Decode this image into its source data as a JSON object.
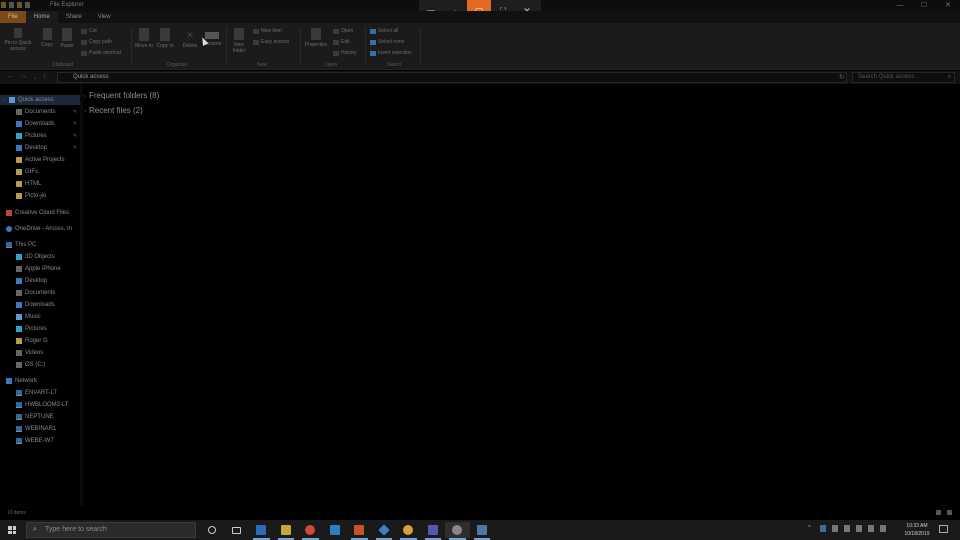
{
  "window": {
    "title": "File Explorer",
    "controls": {
      "minimize": "—",
      "maximize": "☐",
      "close": "✕"
    }
  },
  "snip_toolbar": {
    "buttons": [
      {
        "icon": "rectangle-snip-icon",
        "glyph": "▭"
      },
      {
        "icon": "freeform-snip-icon",
        "glyph": "◌"
      },
      {
        "icon": "window-snip-icon",
        "glyph": "▢",
        "active": true
      },
      {
        "icon": "fullscreen-snip-icon",
        "glyph": "⛶"
      },
      {
        "icon": "close-icon",
        "glyph": "✕"
      }
    ]
  },
  "tabs": [
    "File",
    "Home",
    "Share",
    "View"
  ],
  "ribbon": {
    "clipboard": {
      "pin_label": "Pin to Quick access",
      "copy_label": "Copy",
      "paste_label": "Paste",
      "cut_label": "Cut",
      "copy_path_label": "Copy path",
      "paste_shortcut_label": "Paste shortcut",
      "group_label": "Clipboard"
    },
    "organize": {
      "move_to_label": "Move to",
      "copy_to_label": "Copy to",
      "delete_label": "Delete",
      "rename_label": "Rename",
      "group_label": "Organize"
    },
    "new": {
      "new_folder_label": "New folder",
      "new_item_label": "New item",
      "easy_access_label": "Easy access",
      "group_label": "New"
    },
    "open": {
      "properties_label": "Properties",
      "open_label": "Open",
      "edit_label": "Edit",
      "history_label": "History",
      "group_label": "Open"
    },
    "select": {
      "select_all_label": "Select all",
      "select_none_label": "Select none",
      "invert_selection_label": "Invert selection",
      "group_label": "Select"
    }
  },
  "address_bar": {
    "path": "Quick access",
    "search_placeholder": "Search Quick access"
  },
  "nav_pane": {
    "quick_access_label": "Quick access",
    "quick_access_items": [
      {
        "label": "Documents",
        "icon": "documents-icon",
        "pinned": true
      },
      {
        "label": "Downloads",
        "icon": "downloads-icon",
        "pinned": true
      },
      {
        "label": "Pictures",
        "icon": "pictures-icon",
        "pinned": true
      },
      {
        "label": "Desktop",
        "icon": "desktop-icon",
        "pinned": true
      },
      {
        "label": "Active Projects",
        "icon": "folder-icon",
        "pinned": false
      },
      {
        "label": "GIFs",
        "icon": "folder-icon",
        "pinned": false
      },
      {
        "label": "HTML",
        "icon": "folder-icon",
        "pinned": false
      },
      {
        "label": "Picto-jio",
        "icon": "folder-icon",
        "pinned": false
      }
    ],
    "creative_cloud_label": "Creative Cloud Files",
    "onedrive_label": "OneDrive - Arcoss, In",
    "this_pc_label": "This PC",
    "this_pc_items": [
      {
        "label": "3D Objects",
        "icon": "3d-objects-icon"
      },
      {
        "label": "Apple iPhone",
        "icon": "phone-icon"
      },
      {
        "label": "Desktop",
        "icon": "desktop-icon"
      },
      {
        "label": "Documents",
        "icon": "documents-icon"
      },
      {
        "label": "Downloads",
        "icon": "downloads-icon"
      },
      {
        "label": "Music",
        "icon": "music-icon"
      },
      {
        "label": "Pictures",
        "icon": "pictures-icon"
      },
      {
        "label": "Roger G",
        "icon": "folder-icon"
      },
      {
        "label": "Videos",
        "icon": "videos-icon"
      },
      {
        "label": "OS (C:)",
        "icon": "drive-icon"
      }
    ],
    "network_label": "Network",
    "network_items": [
      "ENVART-LT",
      "HWBLOOM2-LT",
      "NEPTUNE",
      "WEBINAR1",
      "WEBE-W7"
    ]
  },
  "content": {
    "frequent_folders": "Frequent folders (8)",
    "recent_files": "Recent files (2)"
  },
  "status": {
    "items_count": "10 items"
  },
  "taskbar": {
    "search_placeholder": "Type here to search",
    "apps": [
      {
        "icon": "cortana-icon",
        "color": "#1a1a1a",
        "ring": true
      },
      {
        "icon": "task-view-icon",
        "color": "#1a1a1a"
      },
      {
        "icon": "outlook-icon",
        "color": "#2b6cb8",
        "open": true
      },
      {
        "icon": "file-explorer-icon",
        "color": "#c9a63a",
        "open": true
      },
      {
        "icon": "chrome-icon",
        "color": "#d04a35",
        "open": true
      },
      {
        "icon": "edge-icon",
        "color": "#2d7fc5"
      },
      {
        "icon": "powerpoint-icon",
        "color": "#c8532b",
        "open": true
      },
      {
        "icon": "network-app-icon",
        "color": "#3a7fc8",
        "open": true
      },
      {
        "icon": "clock-app-icon",
        "color": "#d7a040",
        "open": true
      },
      {
        "icon": "teams-icon",
        "color": "#5558af",
        "open": true
      },
      {
        "icon": "snip-sketch-icon",
        "color": "#888",
        "active": true,
        "open": true
      },
      {
        "icon": "settings-app-icon",
        "color": "#4a7aa8",
        "open": true
      }
    ],
    "time": "10:33 AM",
    "date": "10/18/2019"
  }
}
